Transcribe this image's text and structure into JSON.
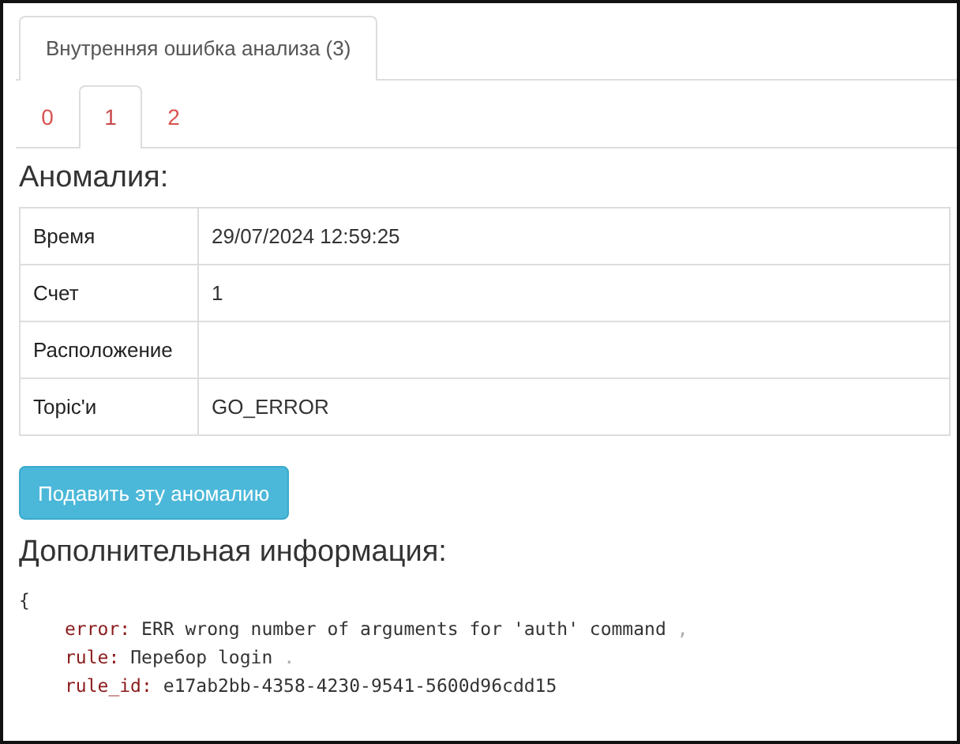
{
  "outer_tabs": [
    {
      "label": "Внутренняя ошибка анализа (3)",
      "selected": true
    }
  ],
  "inner_tabs": [
    {
      "label": "0",
      "selected": false
    },
    {
      "label": "1",
      "selected": true
    },
    {
      "label": "2",
      "selected": false
    }
  ],
  "anomaly_heading": "Аномалия:",
  "table": {
    "rows": [
      {
        "label": "Время",
        "value": "29/07/2024 12:59:25"
      },
      {
        "label": "Счет",
        "value": "1"
      },
      {
        "label": "Расположение",
        "value": ""
      },
      {
        "label": "Topic'и",
        "value": "GO_ERROR"
      }
    ]
  },
  "suppress_button": "Подавить эту аномалию",
  "info_heading": "Дополнительная информация:",
  "info": {
    "open_brace": "{",
    "fields": [
      {
        "key": "error:",
        "value": "ERR wrong number of arguments for 'auth' command",
        "separator": ","
      },
      {
        "key": "rule:",
        "value": "Перебор login",
        "separator": "."
      },
      {
        "key": "rule_id:",
        "value": "e17ab2bb-4358-4230-9541-5600d96cdd15"
      }
    ]
  }
}
